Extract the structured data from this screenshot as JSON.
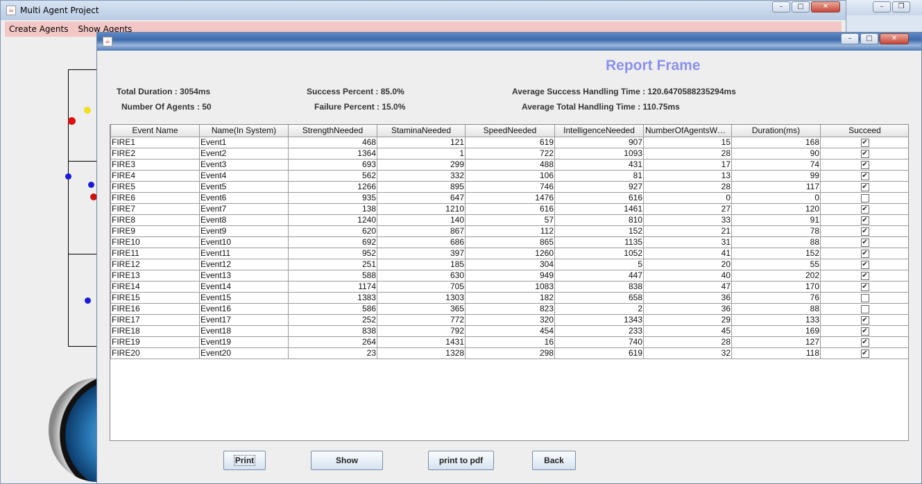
{
  "main_window": {
    "title": "Multi Agent Project",
    "menu": [
      "Create Agents",
      "Show Agents"
    ],
    "controls": {
      "minimize": "–",
      "maximize": "□",
      "close": "✕"
    }
  },
  "report_window": {
    "heading": "Report Frame",
    "controls": {
      "minimize": "–",
      "maximize": "□",
      "close": "✕"
    },
    "stats": {
      "total_duration": "Total Duration : 3054ms",
      "number_of_agents": "Number Of Agents : 50",
      "success_percent": "Success Percent : 85.0%",
      "failure_percent": "Failure Percent : 15.0%",
      "avg_success_time": "Average Success Handling Time : 120.6470588235294ms",
      "avg_total_time": "Average Total Handling Time : 110.75ms"
    },
    "table": {
      "columns": [
        "Event Name",
        "Name(In System)",
        "StrengthNeeded",
        "StaminaNeeded",
        "SpeedNeeded",
        "IntelligenceNeeded",
        "NumberOfAgentsWor...",
        "Duration(ms)",
        "Succeed"
      ],
      "rows": [
        [
          "FIRE1",
          "Event1",
          468,
          121,
          619,
          907,
          15,
          168,
          true
        ],
        [
          "FIRE2",
          "Event2",
          1364,
          1,
          722,
          1093,
          28,
          90,
          true
        ],
        [
          "FIRE3",
          "Event3",
          693,
          299,
          488,
          431,
          17,
          74,
          true
        ],
        [
          "FIRE4",
          "Event4",
          562,
          332,
          106,
          81,
          13,
          99,
          true
        ],
        [
          "FIRE5",
          "Event5",
          1266,
          895,
          746,
          927,
          28,
          117,
          true
        ],
        [
          "FIRE6",
          "Event6",
          935,
          647,
          1476,
          616,
          0,
          0,
          false
        ],
        [
          "FIRE7",
          "Event7",
          138,
          1210,
          616,
          1461,
          27,
          120,
          true
        ],
        [
          "FIRE8",
          "Event8",
          1240,
          140,
          57,
          810,
          33,
          91,
          true
        ],
        [
          "FIRE9",
          "Event9",
          620,
          867,
          112,
          152,
          21,
          78,
          true
        ],
        [
          "FIRE10",
          "Event10",
          692,
          686,
          865,
          1135,
          31,
          88,
          true
        ],
        [
          "FIRE11",
          "Event11",
          952,
          397,
          1260,
          1052,
          41,
          152,
          true
        ],
        [
          "FIRE12",
          "Event12",
          251,
          185,
          304,
          5,
          20,
          55,
          true
        ],
        [
          "FIRE13",
          "Event13",
          588,
          630,
          949,
          447,
          40,
          202,
          true
        ],
        [
          "FIRE14",
          "Event14",
          1174,
          705,
          1083,
          838,
          47,
          170,
          true
        ],
        [
          "FIRE15",
          "Event15",
          1383,
          1303,
          182,
          658,
          36,
          76,
          false
        ],
        [
          "FIRE16",
          "Event16",
          586,
          365,
          823,
          2,
          36,
          88,
          false
        ],
        [
          "FIRE17",
          "Event17",
          252,
          772,
          320,
          1343,
          29,
          133,
          true
        ],
        [
          "FIRE18",
          "Event18",
          838,
          792,
          454,
          233,
          45,
          169,
          true
        ],
        [
          "FIRE19",
          "Event19",
          264,
          1431,
          16,
          740,
          28,
          127,
          true
        ],
        [
          "FIRE20",
          "Event20",
          23,
          1328,
          298,
          619,
          32,
          118,
          true
        ]
      ]
    },
    "buttons": {
      "print": "Print",
      "show": "Show",
      "print_pdf": "print to pdf",
      "back": "Back"
    }
  }
}
